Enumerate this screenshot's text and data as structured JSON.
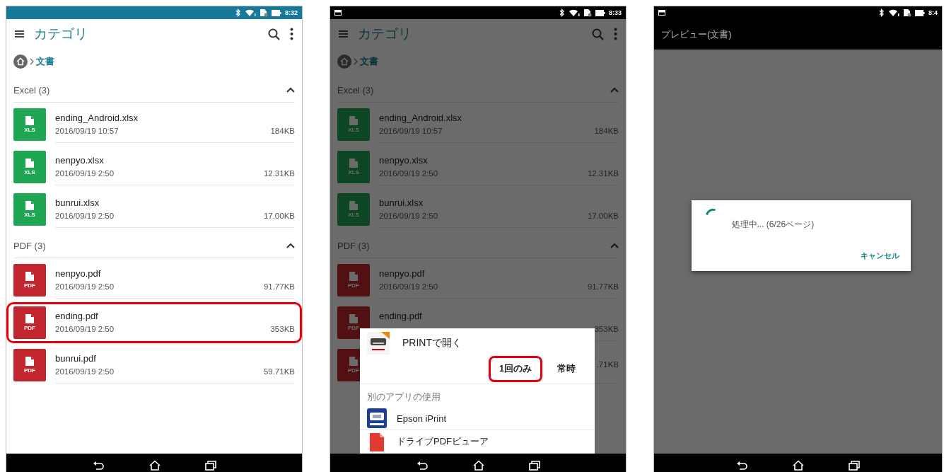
{
  "screens": [
    {
      "kind": "browser",
      "status_bar": {
        "kind": "teal",
        "time": "8:32"
      },
      "app_bar": {
        "title": "カテゴリ"
      },
      "breadcrumb": {
        "current": "文書"
      },
      "groups": [
        {
          "title": "Excel (3)",
          "expanded": true,
          "files": [
            {
              "kind": "xls",
              "icon_label": "XLS",
              "name": "ending_Android.xlsx",
              "date": "2016/09/19 10:57",
              "size": "184KB",
              "highlighted": false
            },
            {
              "kind": "xls",
              "icon_label": "XLS",
              "name": "nenpyo.xlsx",
              "date": "2016/09/19 2:50",
              "size": "12.31KB",
              "highlighted": false
            },
            {
              "kind": "xls",
              "icon_label": "XLS",
              "name": "bunrui.xlsx",
              "date": "2016/09/19 2:50",
              "size": "17.00KB",
              "highlighted": false
            }
          ]
        },
        {
          "title": "PDF (3)",
          "expanded": true,
          "files": [
            {
              "kind": "pdf",
              "icon_label": "PDF",
              "name": "nenpyo.pdf",
              "date": "2016/09/19 2:50",
              "size": "91.77KB",
              "highlighted": false
            },
            {
              "kind": "pdf",
              "icon_label": "PDF",
              "name": "ending.pdf",
              "date": "2016/09/19 2:50",
              "size": "353KB",
              "highlighted": true
            },
            {
              "kind": "pdf",
              "icon_label": "PDF",
              "name": "bunrui.pdf",
              "date": "2016/09/19 2:50",
              "size": "59.71KB",
              "highlighted": false
            }
          ]
        }
      ]
    },
    {
      "kind": "browser",
      "status_bar": {
        "kind": "dark",
        "time": "8:33"
      },
      "app_bar": {
        "title": "カテゴリ"
      },
      "breadcrumb": {
        "current": "文書"
      },
      "dimmed": true,
      "groups": [
        {
          "title": "Excel (3)",
          "expanded": true,
          "files": [
            {
              "kind": "xls",
              "icon_label": "XLS",
              "name": "ending_Android.xlsx",
              "date": "2016/09/19 10:57",
              "size": "184KB",
              "highlighted": false
            },
            {
              "kind": "xls",
              "icon_label": "XLS",
              "name": "nenpyo.xlsx",
              "date": "2016/09/19 2:50",
              "size": "12.31KB",
              "highlighted": false
            },
            {
              "kind": "xls",
              "icon_label": "XLS",
              "name": "bunrui.xlsx",
              "date": "2016/09/19 2:50",
              "size": "17.00KB",
              "highlighted": false
            }
          ]
        },
        {
          "title": "PDF (3)",
          "expanded": true,
          "files": [
            {
              "kind": "pdf",
              "icon_label": "PDF",
              "name": "nenpyo.pdf",
              "date": "2016/09/19 2:50",
              "size": "91.77KB",
              "highlighted": false
            },
            {
              "kind": "pdf",
              "icon_label": "PDF",
              "name": "ending.pdf",
              "size": "353KB",
              "highlighted": false
            },
            {
              "kind": "pdf",
              "icon_label": "PDF",
              "size": ".71KB",
              "highlighted": false
            }
          ]
        }
      ],
      "sheet": {
        "title": "PRINTで開く",
        "actions": [
          {
            "label": "1回のみ",
            "highlighted": true
          },
          {
            "label": "常時",
            "highlighted": false
          }
        ],
        "section": "別のアプリの使用",
        "apps": [
          {
            "kind": "printer",
            "name": "Epson iPrint"
          },
          {
            "kind": "pdf",
            "name": "ドライブPDFビューア"
          }
        ]
      }
    },
    {
      "kind": "preview",
      "status_bar": {
        "kind": "dark",
        "time": "8:4"
      },
      "title": "プレビュー(文書)",
      "dialog": {
        "message": "処理中... (6/26ページ)",
        "button": "キャンセル"
      }
    }
  ]
}
